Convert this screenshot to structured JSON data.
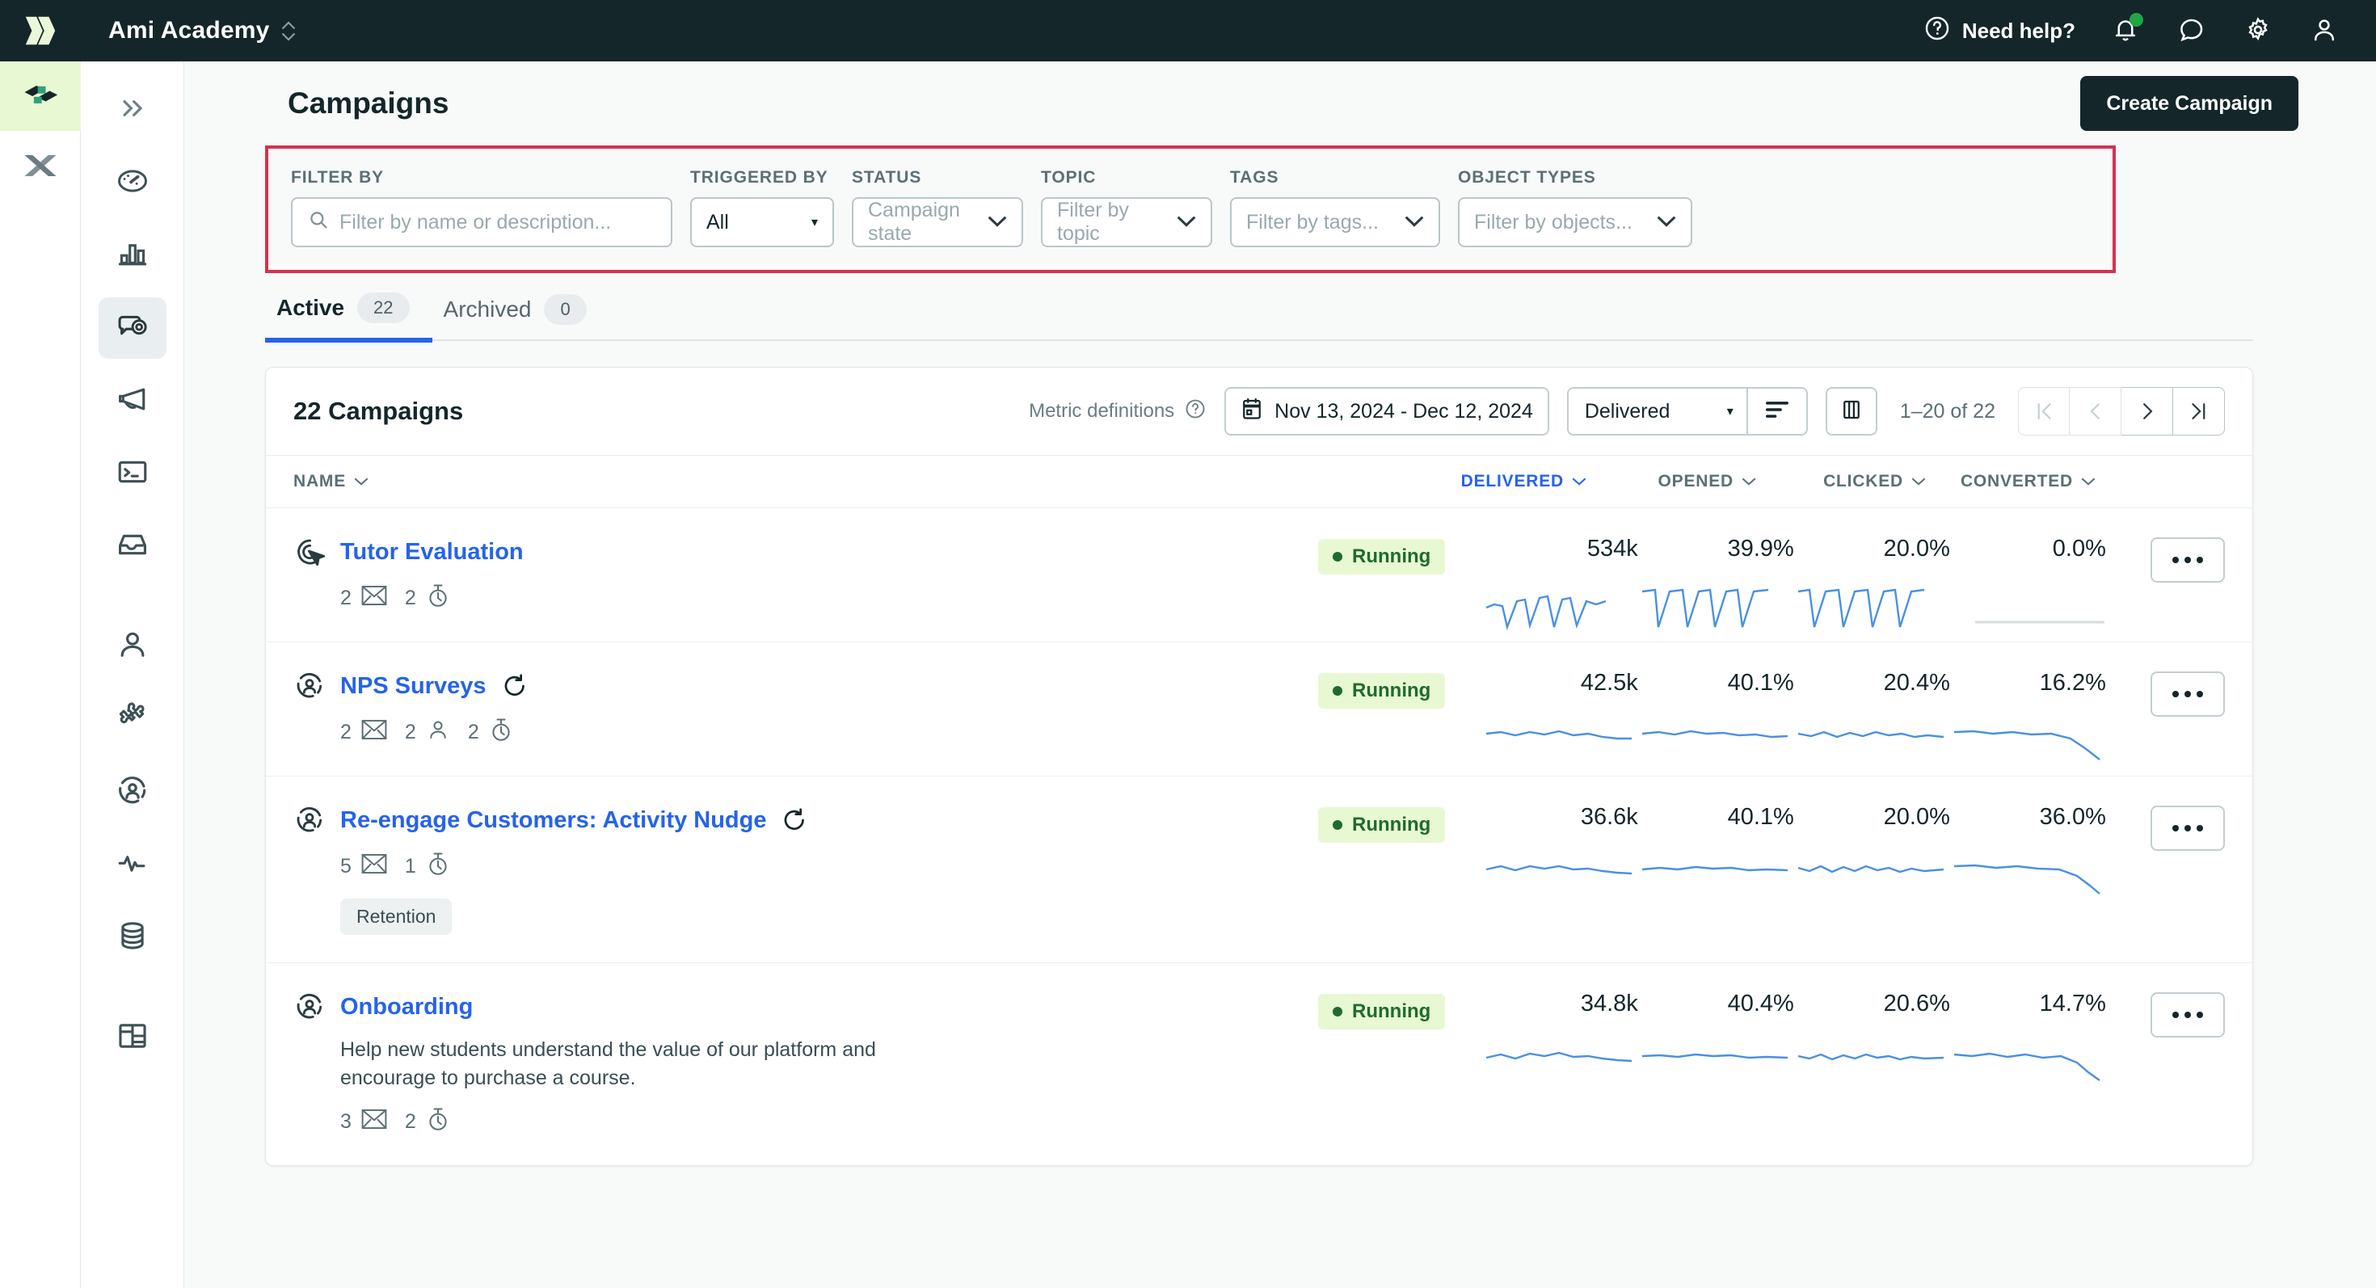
{
  "topbar": {
    "logo_icon": "double-chevron-logo",
    "workspace_name": "Ami Academy",
    "workspace_switcher_icon": "up-down-chevron-icon",
    "need_help_label": "Need help?",
    "help_icon": "question-circle-icon",
    "notifications_icon": "bell-icon",
    "chat_icon": "chat-bubble-icon",
    "settings_icon": "gear-icon",
    "account_icon": "user-icon",
    "notification_badge_color": "#22a447",
    "background_color": "#14262a"
  },
  "app_rail": {
    "items": [
      {
        "name": "app-switcher-journeys",
        "icon": "blocks-logo-icon",
        "active": true
      },
      {
        "name": "app-switcher-data",
        "icon": "x-cross-logo-icon",
        "active": false
      }
    ]
  },
  "nav_rail": {
    "collapse_icon": "double-chevron-right-icon",
    "items": [
      {
        "name": "dashboard",
        "icon": "gauge-icon",
        "selected": false
      },
      {
        "name": "analytics",
        "icon": "bar-chart-icon",
        "selected": false
      },
      {
        "name": "campaigns",
        "icon": "message-eye-icon",
        "selected": true
      },
      {
        "name": "broadcasts",
        "icon": "megaphone-icon",
        "selected": false
      },
      {
        "name": "api-console",
        "icon": "terminal-icon",
        "selected": false
      },
      {
        "name": "inbox",
        "icon": "inbox-icon",
        "selected": false
      },
      {
        "name": "people",
        "icon": "person-icon",
        "selected": false
      },
      {
        "name": "integrations",
        "icon": "puzzle-piece-icon",
        "selected": false
      },
      {
        "name": "segments",
        "icon": "person-circle-icon",
        "selected": false
      },
      {
        "name": "activity",
        "icon": "pulse-icon",
        "selected": false
      },
      {
        "name": "data-sources",
        "icon": "database-icon",
        "selected": false
      },
      {
        "name": "layouts",
        "icon": "table-layout-icon",
        "selected": false
      }
    ]
  },
  "page": {
    "title": "Campaigns",
    "create_button": "Create Campaign"
  },
  "filters": {
    "highlight_color": "#d6314f",
    "filter_by": {
      "label": "FILTER BY",
      "placeholder": "Filter by name or description...",
      "value": "",
      "icon": "search-icon"
    },
    "triggered_by": {
      "label": "TRIGGERED BY",
      "value": "All"
    },
    "status": {
      "label": "STATUS",
      "value": "Campaign state"
    },
    "topic": {
      "label": "TOPIC",
      "value": "Filter by topic"
    },
    "tags": {
      "label": "TAGS",
      "value": "Filter by tags..."
    },
    "object_types": {
      "label": "OBJECT TYPES",
      "value": "Filter by objects..."
    }
  },
  "tabs": [
    {
      "label": "Active",
      "count": "22",
      "active": true
    },
    {
      "label": "Archived",
      "count": "0",
      "active": false
    }
  ],
  "toolbar": {
    "count_title": "22 Campaigns",
    "metric_definitions": "Metric definitions",
    "metric_definitions_icon": "question-circle-icon",
    "date_range": "Nov 13, 2024 - Dec 12, 2024",
    "date_range_icon": "calendar-icon",
    "sort_metric": "Delivered",
    "sort_direction_icon": "sort-descending-icon",
    "columns_icon": "columns-icon",
    "pagination_label": "1–20 of 22",
    "pager": [
      {
        "name": "first-page-button",
        "glyph": "|<",
        "disabled": true
      },
      {
        "name": "previous-page-button",
        "glyph": "‹",
        "disabled": true
      },
      {
        "name": "next-page-button",
        "glyph": "›",
        "disabled": false
      },
      {
        "name": "last-page-button",
        "glyph": "›|",
        "disabled": false
      }
    ]
  },
  "table": {
    "columns": [
      {
        "key": "name",
        "label": "NAME",
        "sorted": false
      },
      {
        "key": "delivered",
        "label": "DELIVERED",
        "sorted": true
      },
      {
        "key": "opened",
        "label": "OPENED",
        "sorted": false
      },
      {
        "key": "clicked",
        "label": "CLICKED",
        "sorted": false
      },
      {
        "key": "converted",
        "label": "CONVERTED",
        "sorted": false
      }
    ],
    "rows": [
      {
        "name": "Tutor Evaluation",
        "trigger_icon": "click-tap-trigger-icon",
        "repeats": false,
        "description": "",
        "counts": [
          {
            "value": "2",
            "icon": "email-icon"
          },
          {
            "value": "2",
            "icon": "timer-icon"
          }
        ],
        "tags": [],
        "status": "Running",
        "delivered": "534k",
        "opened": "39.9%",
        "clicked": "20.0%",
        "converted": "0.0%",
        "converted_empty": true
      },
      {
        "name": "NPS Surveys",
        "trigger_icon": "person-circle-trigger-icon",
        "repeats": true,
        "description": "",
        "counts": [
          {
            "value": "2",
            "icon": "email-icon"
          },
          {
            "value": "2",
            "icon": "person-icon"
          },
          {
            "value": "2",
            "icon": "timer-icon"
          }
        ],
        "tags": [],
        "status": "Running",
        "delivered": "42.5k",
        "opened": "40.1%",
        "clicked": "20.4%",
        "converted": "16.2%",
        "converted_empty": false
      },
      {
        "name": "Re-engage Customers: Activity Nudge",
        "trigger_icon": "person-circle-trigger-icon",
        "repeats": true,
        "description": "",
        "counts": [
          {
            "value": "5",
            "icon": "email-icon"
          },
          {
            "value": "1",
            "icon": "timer-icon"
          }
        ],
        "tags": [
          "Retention"
        ],
        "status": "Running",
        "delivered": "36.6k",
        "opened": "40.1%",
        "clicked": "20.0%",
        "converted": "36.0%",
        "converted_empty": false
      },
      {
        "name": "Onboarding",
        "trigger_icon": "person-circle-trigger-icon",
        "repeats": false,
        "description": "Help new students understand the value of our platform and encourage to purchase a course.",
        "counts": [
          {
            "value": "3",
            "icon": "email-icon"
          },
          {
            "value": "2",
            "icon": "timer-icon"
          }
        ],
        "tags": [],
        "status": "Running",
        "delivered": "34.8k",
        "opened": "40.4%",
        "clicked": "20.6%",
        "converted": "14.7%",
        "converted_empty": false
      }
    ],
    "kebab_icon": "more-options-icon",
    "sparkline_color": "#4a90e2"
  }
}
